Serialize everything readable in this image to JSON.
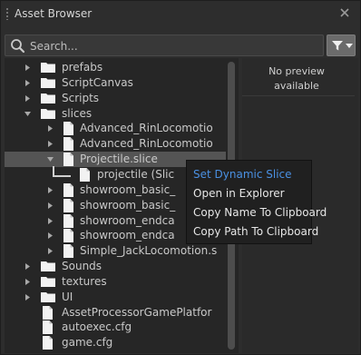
{
  "window": {
    "title": "Asset Browser"
  },
  "search": {
    "placeholder": "Search..."
  },
  "tree": [
    {
      "label": "prefabs",
      "kind": "folder",
      "expanded": false,
      "depth": 0
    },
    {
      "label": "ScriptCanvas",
      "kind": "folder",
      "expanded": false,
      "depth": 0
    },
    {
      "label": "Scripts",
      "kind": "folder",
      "expanded": false,
      "depth": 0
    },
    {
      "label": "slices",
      "kind": "folder",
      "expanded": true,
      "depth": 0
    },
    {
      "label": "Advanced_RinLocomotio",
      "kind": "file",
      "expanded": false,
      "depth": 1
    },
    {
      "label": "Advanced_RinLocomotio",
      "kind": "file",
      "expanded": false,
      "depth": 1
    },
    {
      "label": "Projectile.slice",
      "kind": "file",
      "expanded": true,
      "depth": 1,
      "highlighted": true
    },
    {
      "label": "projectile (Slic",
      "kind": "child",
      "depth": 2
    },
    {
      "label": "showroom_basic_",
      "kind": "file",
      "expanded": false,
      "depth": 1
    },
    {
      "label": "showroom_basic_",
      "kind": "file",
      "expanded": false,
      "depth": 1
    },
    {
      "label": "showroom_endca",
      "kind": "file",
      "expanded": false,
      "depth": 1
    },
    {
      "label": "showroom_endca",
      "kind": "file",
      "expanded": false,
      "depth": 1
    },
    {
      "label": "Simple_JackLocomotion.s",
      "kind": "file",
      "expanded": false,
      "depth": 1
    },
    {
      "label": "Sounds",
      "kind": "folder",
      "expanded": false,
      "depth": 0
    },
    {
      "label": "textures",
      "kind": "folder",
      "expanded": false,
      "depth": 0
    },
    {
      "label": "UI",
      "kind": "folder",
      "expanded": false,
      "depth": 0
    },
    {
      "label": "AssetProcessorGamePlatfor",
      "kind": "file",
      "leaf": true,
      "depth": 0
    },
    {
      "label": "autoexec.cfg",
      "kind": "file",
      "leaf": true,
      "depth": 0
    },
    {
      "label": "game.cfg",
      "kind": "file",
      "leaf": true,
      "depth": 0
    }
  ],
  "preview": {
    "line1": "No preview",
    "line2": "available"
  },
  "context_menu": {
    "items": [
      {
        "label": "Set Dynamic Slice",
        "active": true
      },
      {
        "label": "Open in Explorer",
        "active": false
      },
      {
        "label": "Copy Name To Clipboard",
        "active": false
      },
      {
        "label": "Copy Path To Clipboard",
        "active": false
      }
    ]
  },
  "colors": {
    "accent": "#4a90e2",
    "background": "#2d2d2d",
    "panel": "#262626",
    "highlight_row": "#545454",
    "menu_bg": "#202020",
    "text": "#cccccc"
  },
  "icons": {
    "close": "close-icon",
    "search": "search-icon",
    "filter": "filter-icon",
    "folder": "folder-icon",
    "file": "file-icon"
  }
}
